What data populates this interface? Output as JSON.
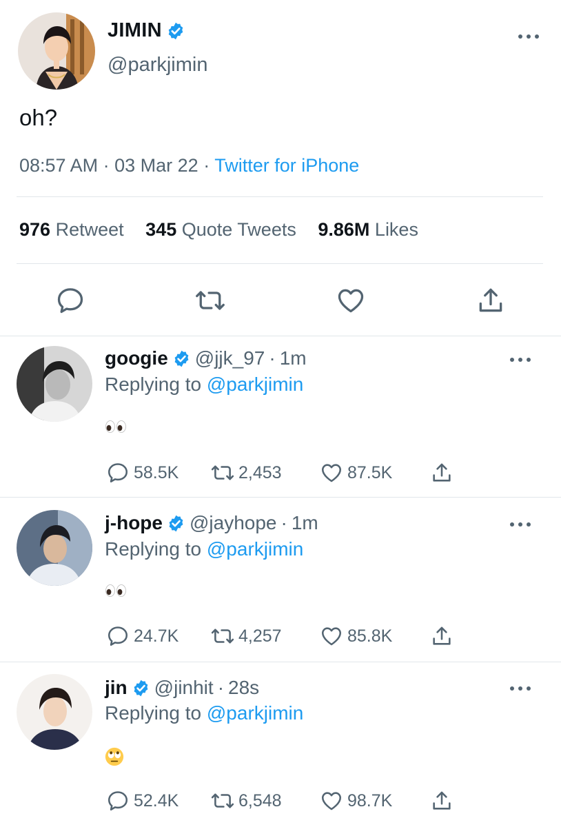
{
  "main_tweet": {
    "display_name": "JIMIN",
    "handle": "@parkjimin",
    "text": "oh?",
    "time": "08:57 AM",
    "date": "03 Mar 22",
    "source": "Twitter for iPhone",
    "stats": {
      "retweets": "976",
      "retweets_label": "Retweet",
      "quotes": "345",
      "quotes_label": "Quote Tweets",
      "likes": "9.86M",
      "likes_label": "Likes"
    }
  },
  "replies": [
    {
      "display_name": "googie",
      "handle": "@jjk_97",
      "time": "1m",
      "replying_prefix": "Replying to",
      "replying_to": "@parkjimin",
      "content_emoji": "eyes",
      "replies": "58.5K",
      "retweets": "2,453",
      "likes": "87.5K"
    },
    {
      "display_name": "j-hope",
      "handle": "@jayhope",
      "time": "1m",
      "replying_prefix": "Replying to",
      "replying_to": "@parkjimin",
      "content_emoji": "eyes",
      "replies": "24.7K",
      "retweets": "4,257",
      "likes": "85.8K"
    },
    {
      "display_name": "jin",
      "handle": "@jinhit",
      "time": "28s",
      "replying_prefix": "Replying to",
      "replying_to": "@parkjimin",
      "content_emoji": "face-with-rolling-eyes",
      "replies": "52.4K",
      "retweets": "6,548",
      "likes": "98.7K"
    }
  ],
  "colors": {
    "link": "#1d9bf0",
    "muted": "#536471",
    "text": "#0f1419",
    "divider": "#e1e6ea"
  },
  "icons": [
    "verified-badge-icon",
    "more-options-icon",
    "reply-icon",
    "retweet-icon",
    "like-icon",
    "share-icon",
    "eyes-emoji",
    "rolling-eyes-emoji"
  ]
}
